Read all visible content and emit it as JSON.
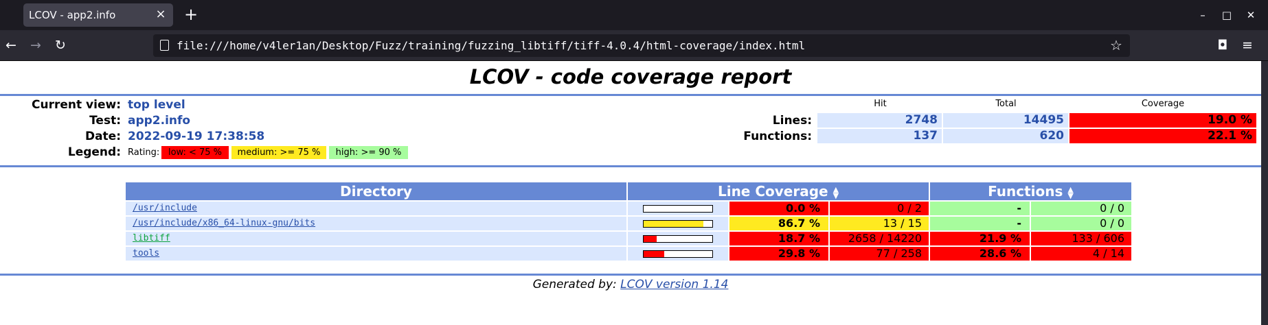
{
  "browser": {
    "tab_title": "LCOV - app2.info",
    "url": "file:///home/v4ler1an/Desktop/Fuzz/training/fuzzing_libtiff/tiff-4.0.4/html-coverage/index.html",
    "icons": {
      "tab_close": "×",
      "new_tab": "+",
      "back": "←",
      "forward": "→",
      "reload": "↻",
      "star": "☆",
      "pocket": "◘",
      "menu": "≡",
      "minimize": "–",
      "maximize": "□",
      "close": "✕"
    }
  },
  "report": {
    "title": "LCOV - code coverage report",
    "current_view_label": "Current view:",
    "current_view": "top level",
    "test_label": "Test:",
    "test": "app2.info",
    "date_label": "Date:",
    "date": "2022-09-19 17:38:58",
    "legend_label": "Legend:",
    "rating_label": "Rating:",
    "legend": {
      "low": "low: < 75 %",
      "medium": "medium: >= 75 %",
      "high": "high: >= 90 %"
    },
    "summary": {
      "headers": {
        "hit": "Hit",
        "total": "Total",
        "coverage": "Coverage"
      },
      "lines": {
        "label": "Lines:",
        "hit": "2748",
        "total": "14495",
        "coverage": "19.0 %"
      },
      "functions": {
        "label": "Functions:",
        "hit": "137",
        "total": "620",
        "coverage": "22.1 %"
      }
    }
  },
  "table": {
    "headers": {
      "directory": "Directory",
      "line_coverage": "Line Coverage",
      "functions": "Functions"
    },
    "sort_icon": "▲▼",
    "rows": [
      {
        "name": "/usr/include",
        "bar_fraction": 0.0,
        "line_pct": "0.0 %",
        "line_hits": "0 / 2",
        "fn_pct": "-",
        "fn_hits": "0 / 0"
      },
      {
        "name": "/usr/include/x86_64-linux-gnu/bits",
        "bar_fraction": 0.867,
        "line_pct": "86.7 %",
        "line_hits": "13 / 15",
        "fn_pct": "-",
        "fn_hits": "0 / 0"
      },
      {
        "name": "libtiff",
        "bar_fraction": 0.187,
        "line_pct": "18.7 %",
        "line_hits": "2658 / 14220",
        "fn_pct": "21.9 %",
        "fn_hits": "133 / 606"
      },
      {
        "name": "tools",
        "bar_fraction": 0.298,
        "line_pct": "29.8 %",
        "line_hits": "77 / 258",
        "fn_pct": "28.6 %",
        "fn_hits": "4 / 14"
      }
    ]
  },
  "footer": {
    "prefix": "Generated by:",
    "link": "LCOV version 1.14"
  },
  "colors": {
    "low": "#ff0000",
    "medium": "#ffea20",
    "high": "#a7fc9d",
    "header_blue": "#6688d4",
    "cell_blue": "#dae7fe",
    "link_blue": "#284fa8"
  }
}
